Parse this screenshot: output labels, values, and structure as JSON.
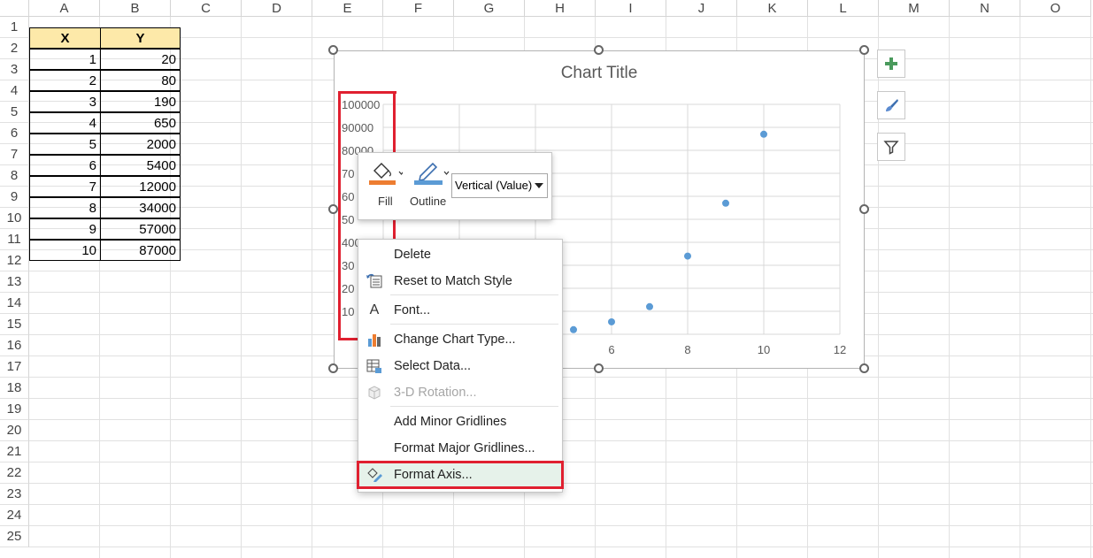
{
  "columns": [
    "A",
    "B",
    "C",
    "D",
    "E",
    "F",
    "G",
    "H",
    "I",
    "J",
    "K",
    "L",
    "M",
    "N",
    "O"
  ],
  "rows": [
    "1",
    "2",
    "3",
    "4",
    "5",
    "6",
    "7",
    "8",
    "9",
    "10",
    "11",
    "12",
    "13",
    "14",
    "15",
    "16",
    "17",
    "18",
    "19",
    "20",
    "21",
    "22",
    "23",
    "24",
    "25"
  ],
  "table": {
    "headers": [
      "X",
      "Y"
    ],
    "x": [
      "1",
      "2",
      "3",
      "4",
      "5",
      "6",
      "7",
      "8",
      "9",
      "10"
    ],
    "y": [
      "20",
      "80",
      "190",
      "650",
      "2000",
      "5400",
      "12000",
      "34000",
      "57000",
      "87000"
    ]
  },
  "chart": {
    "title": "Chart Title",
    "y_ticks_visible": [
      "100000",
      "90000",
      "80000",
      "70",
      "60",
      "50",
      "40000",
      "30",
      "20",
      "10"
    ],
    "x_ticks_visible": [
      "6",
      "8",
      "10",
      "12"
    ]
  },
  "chart_data": {
    "type": "scatter",
    "title": "Chart Title",
    "x": [
      1,
      2,
      3,
      4,
      5,
      6,
      7,
      8,
      9,
      10
    ],
    "y": [
      20,
      80,
      190,
      650,
      2000,
      5400,
      12000,
      34000,
      57000,
      87000
    ],
    "xlim": [
      0,
      12
    ],
    "ylim": [
      0,
      100000
    ],
    "grid": true,
    "color": "#5b9bd5"
  },
  "minibar": {
    "fill_label": "Fill",
    "outline_label": "Outline",
    "element_select": "Vertical (Value)"
  },
  "menu": {
    "delete": "Delete",
    "reset": "Reset to Match Style",
    "font": "Font...",
    "change_type": "Change Chart Type...",
    "select_data": "Select Data...",
    "rotation": "3-D Rotation...",
    "add_minor": "Add Minor Gridlines",
    "format_major": "Format Major Gridlines...",
    "format_axis": "Format Axis..."
  },
  "colors": {
    "header_fill": "#fde9a9",
    "marker": "#5b9bd5",
    "highlight": "#e02030"
  }
}
